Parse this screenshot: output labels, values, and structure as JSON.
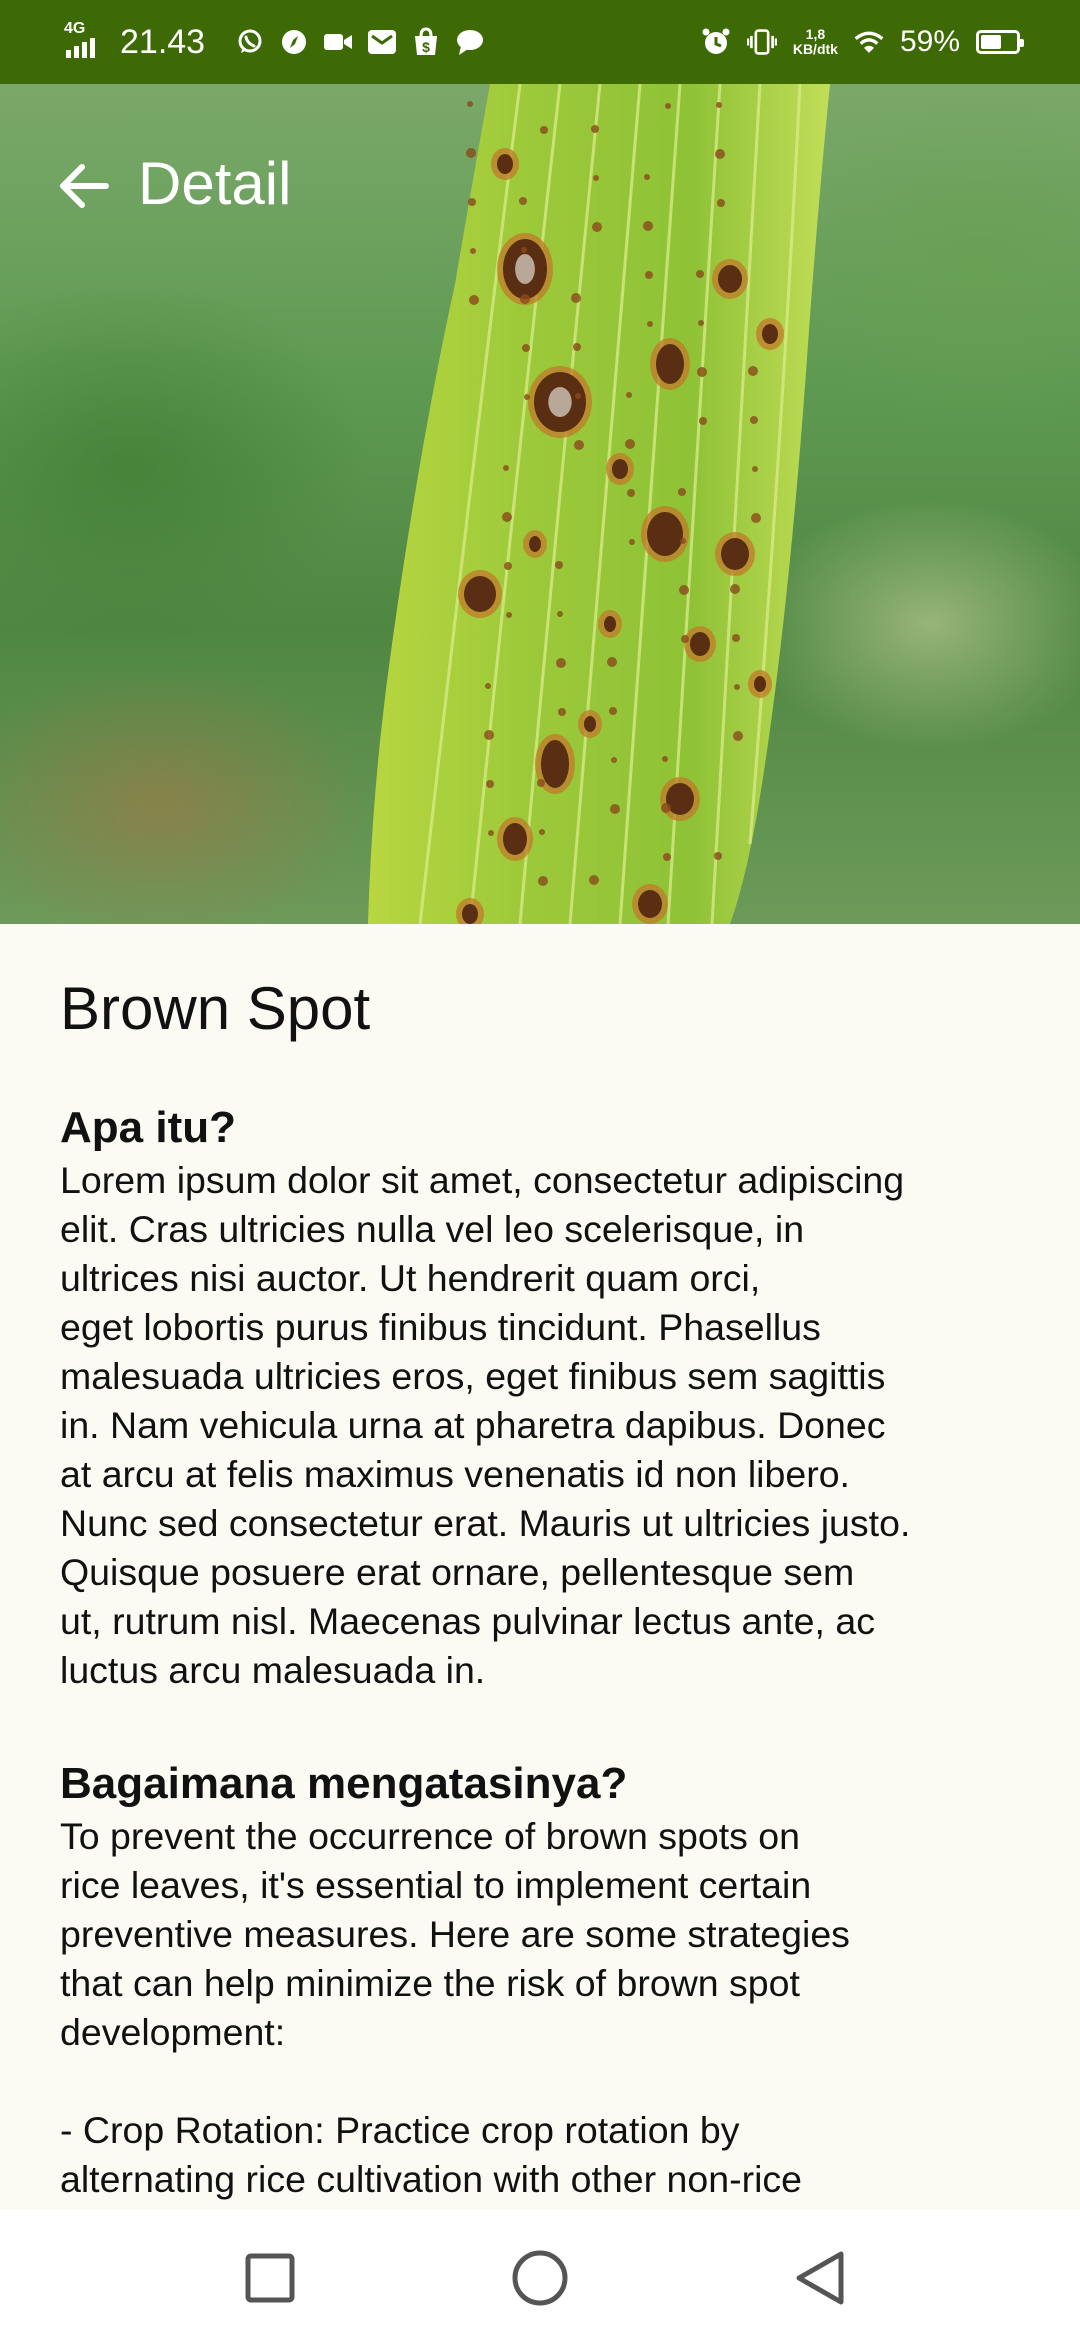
{
  "status_bar": {
    "network": "4G",
    "time": "21.43",
    "speed_value": "1,8",
    "speed_unit": "KB/dtk",
    "battery": "59%",
    "battery_level": 0.59,
    "notification_icons": [
      "whatsapp-icon",
      "compass-icon",
      "video-icon",
      "gmail-icon",
      "shop-icon",
      "chat-icon"
    ],
    "system_icons": [
      "alarm-icon",
      "vibrate-icon",
      "wifi-icon",
      "battery-icon"
    ]
  },
  "app_bar": {
    "title": "Detail",
    "back_icon": "arrow-left-icon"
  },
  "hero": {
    "subject": "leaf-with-brown-spots"
  },
  "disease": {
    "name": "Brown Spot",
    "sections": [
      {
        "heading": "Apa itu?",
        "body": "Lorem ipsum dolor sit amet, consectetur adipiscing\nelit. Cras ultricies nulla vel leo scelerisque, in\nultrices nisi auctor. Ut hendrerit quam orci,\neget lobortis purus finibus tincidunt. Phasellus\nmalesuada ultricies eros, eget finibus sem sagittis\nin. Nam vehicula urna at pharetra dapibus. Donec\nat arcu at felis maximus venenatis id non libero.\nNunc sed consectetur erat. Mauris ut ultricies justo.\nQuisque posuere erat ornare, pellentesque sem\nut, rutrum nisl. Maecenas pulvinar lectus ante, ac\nluctus arcu malesuada in."
      },
      {
        "heading": "Bagaimana mengatasinya?",
        "body": "To prevent the occurrence of brown spots on\nrice leaves, it's essential to implement certain\npreventive measures. Here are some strategies\nthat can help minimize the risk of brown spot\ndevelopment:\n\n- Crop Rotation: Practice crop rotation by\nalternating rice cultivation with other non-rice"
      }
    ]
  },
  "nav_bar": {
    "buttons": [
      "recents-square-icon",
      "home-circle-icon",
      "back-triangle-icon"
    ]
  },
  "colors": {
    "status_bar_bg": "#3e6a06",
    "content_bg": "#fcfbf3",
    "text": "#111111"
  }
}
